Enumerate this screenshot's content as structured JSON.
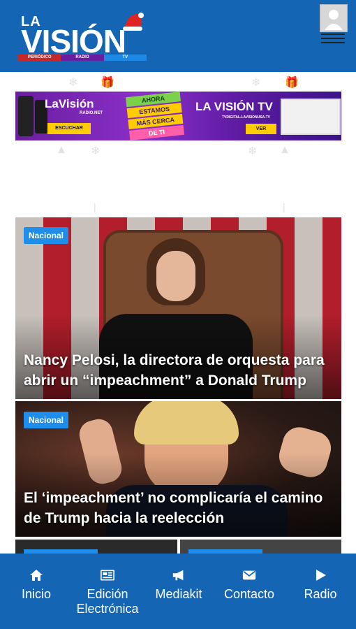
{
  "header": {
    "logo_top": "LA",
    "logo_main": "VISIÓN",
    "logo_bar": [
      "PERIÓDICO",
      "RADIO",
      "TV"
    ]
  },
  "banner": {
    "radio_brand": "LaVisión",
    "radio_sub": "RADIO.NET",
    "listen_label": "ESCUCHAR",
    "message_lines": [
      "AHORA",
      "ESTAMOS",
      "MÁS CERCA",
      "DE TI"
    ],
    "tv_brand": "LA VISIÓN TV",
    "tv_url": "TVDIGITAL.LAVISIONUSA.TV",
    "watch_label": "VER"
  },
  "articles": [
    {
      "category": "Nacional",
      "headline": "Nancy Pelosi, la directora de orquesta para abrir un “impeachment” a Donald Trump"
    },
    {
      "category": "Nacional",
      "headline": "El ‘impeachment’ no complicaría el camino de Trump hacia la reelección"
    }
  ],
  "nav": {
    "items": [
      {
        "label": "Inicio",
        "icon": "home-icon"
      },
      {
        "label": "Edición Electrónica",
        "icon": "newspaper-icon"
      },
      {
        "label": "Mediakit",
        "icon": "megaphone-icon"
      },
      {
        "label": "Contacto",
        "icon": "envelope-icon"
      },
      {
        "label": "Radio",
        "icon": "play-icon"
      }
    ]
  },
  "colors": {
    "brand_blue": "#1565b5",
    "badge_blue": "#1f8dea",
    "accent_yellow": "#ffcc00"
  }
}
